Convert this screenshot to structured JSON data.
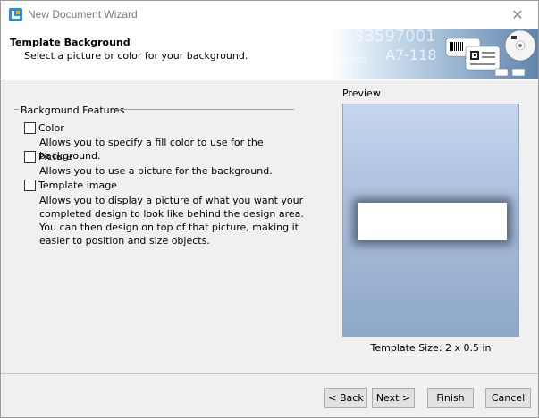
{
  "window": {
    "title": "New Document Wizard",
    "close_label": "✕"
  },
  "header": {
    "title": "Template Background",
    "subtitle": "Select a picture or color for your background.",
    "banner": {
      "number_text": "33597001",
      "code_text": "A7-118",
      "small_text": "38000"
    }
  },
  "group": {
    "label": "Background Features",
    "options": [
      {
        "label": "Color",
        "checked": false,
        "description": "Allows you to specify a fill color to use for the background."
      },
      {
        "label": "Picture",
        "checked": false,
        "description": "Allows you to use a picture for the background."
      },
      {
        "label": "Template image",
        "checked": false,
        "description": "Allows you to display a picture of what you want your completed design to look like behind the design area. You can then design on top of that picture, making it easier to position and size objects."
      }
    ]
  },
  "preview": {
    "label": "Preview",
    "template_size": "Template Size:  2 x 0.5 in"
  },
  "buttons": {
    "back": "< Back",
    "next": "Next >",
    "finish": "Finish",
    "cancel": "Cancel"
  }
}
